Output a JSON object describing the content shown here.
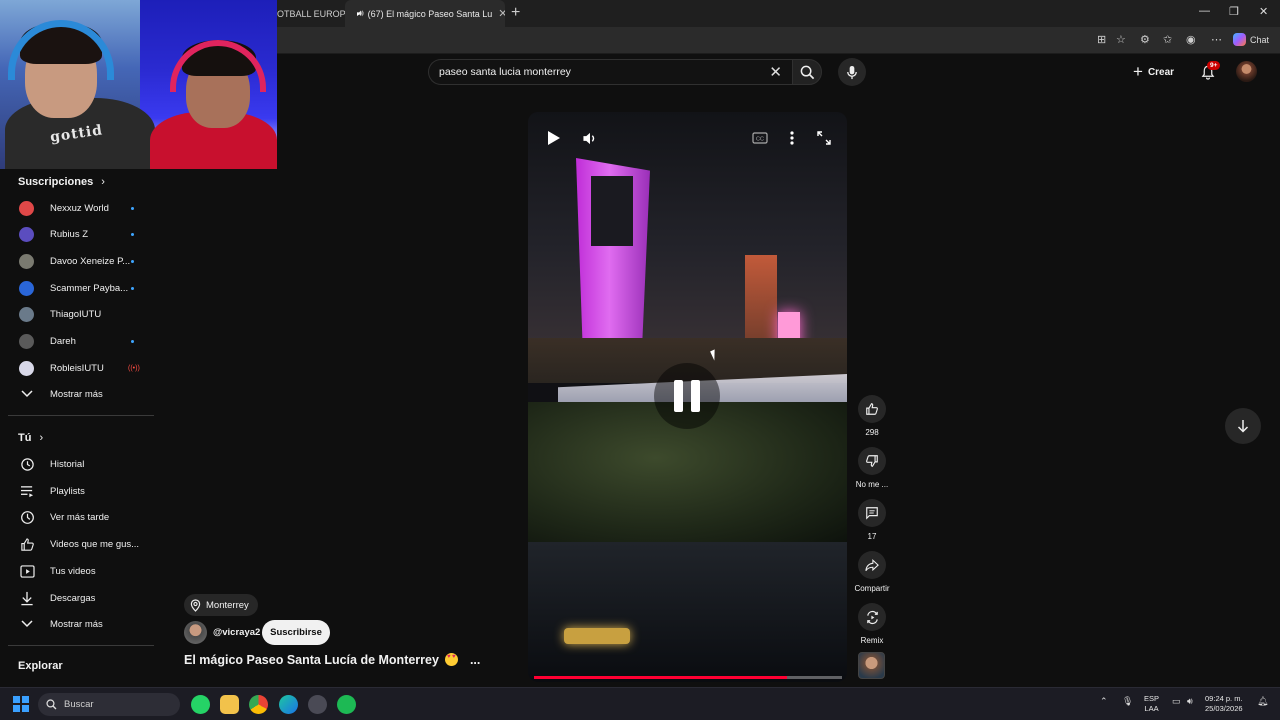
{
  "browser": {
    "tabs": [
      {
        "label": "OTBALL EUROP"
      },
      {
        "label": "(67) El mágico Paseo Santa Lu"
      }
    ],
    "new_tab": "+",
    "chat_label": "Chat"
  },
  "header": {
    "search_query": "paseo santa lucia monterrey",
    "create_label": "Crear",
    "notifications_badge": "9+"
  },
  "sidebar": {
    "subscriptions_title": "Suscripciones",
    "subscriptions": [
      {
        "label": "Nexxuz World",
        "indicator": "dot",
        "color": "#e04848"
      },
      {
        "label": "Rubius Z",
        "indicator": "dot",
        "color": "#5b4dbf"
      },
      {
        "label": "Davoo Xeneize P...",
        "indicator": "dot",
        "color": "#7a7a70"
      },
      {
        "label": "Scammer Payba...",
        "indicator": "dot",
        "color": "#2a66d8"
      },
      {
        "label": "ThiagoIUTU",
        "indicator": "none",
        "color": "#6a7a8a"
      },
      {
        "label": "Dareh",
        "indicator": "dot",
        "color": "#5a5a5a"
      },
      {
        "label": "RobleisIUTU",
        "indicator": "live",
        "color": "#d8d8e8"
      }
    ],
    "show_more_1": "Mostrar más",
    "you_title": "Tú",
    "you_items": [
      {
        "label": "Historial",
        "icon": "history-icon"
      },
      {
        "label": "Playlists",
        "icon": "playlists-icon"
      },
      {
        "label": "Ver más tarde",
        "icon": "watch-later-icon"
      },
      {
        "label": "Videos que me gus...",
        "icon": "liked-videos-icon"
      },
      {
        "label": "Tus videos",
        "icon": "your-videos-icon"
      },
      {
        "label": "Descargas",
        "icon": "downloads-icon"
      }
    ],
    "show_more_2": "Mostrar más",
    "explore_title": "Explorar"
  },
  "video": {
    "progress_fraction": 0.82,
    "location": "Monterrey",
    "channel": "@vicraya2",
    "subscribe_label": "Suscribirse",
    "title": "El mágico Paseo Santa Lucía de Monterrey",
    "more": "..."
  },
  "actions": {
    "likes": "298",
    "dislike_label": "No me ...",
    "comments": "17",
    "share_label": "Compartir",
    "remix_label": "Remix"
  },
  "taskbar": {
    "search_label": "Buscar",
    "lang_line1": "ESP",
    "lang_line2": "LAA",
    "time": "09:24 p. m.",
    "date": "25/03/2026"
  },
  "webcam": {
    "shirt_text": "gottid"
  }
}
